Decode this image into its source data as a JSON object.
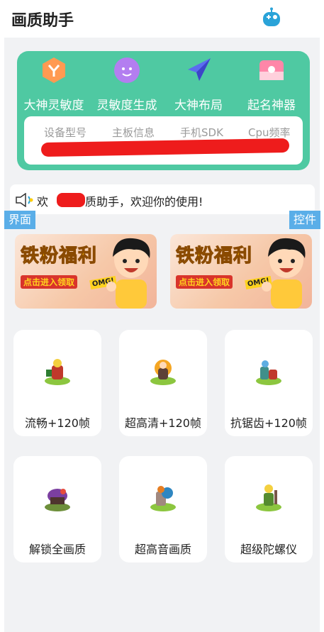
{
  "header": {
    "title": "画质助手",
    "icon": "robot-icon"
  },
  "features": [
    {
      "label": "大神灵敏度",
      "icon": "orange-shield-icon"
    },
    {
      "label": "灵敏度生成",
      "icon": "purple-face-icon"
    },
    {
      "label": "大神布局",
      "icon": "paper-plane-icon"
    },
    {
      "label": "起名神器",
      "icon": "pink-card-icon"
    }
  ],
  "device_info": {
    "labels": [
      "设备型号",
      "主板信息",
      "手机SDK",
      "Cpu频率"
    ]
  },
  "welcome": {
    "text": "欢迎质助手，欢迎你的使用!",
    "prefix": "欢",
    "suffix": "质助手，欢迎你的使用!"
  },
  "tags": {
    "left": "界面",
    "right": "控件"
  },
  "banners": [
    {
      "title": "铁粉福利",
      "subtitle": "点击进入领取",
      "badge": "OMG!"
    },
    {
      "title": "铁粉福利",
      "subtitle": "点击进入领取",
      "badge": "OMG!"
    }
  ],
  "tiles": [
    {
      "label": "流畅+120帧",
      "icon": "game-character-icon"
    },
    {
      "label": "超高清+120帧",
      "icon": "game-character-icon"
    },
    {
      "label": "抗锯齿+120帧",
      "icon": "game-character-icon"
    },
    {
      "label": "解锁全画质",
      "icon": "game-character-icon"
    },
    {
      "label": "超高音画质",
      "icon": "game-character-icon"
    },
    {
      "label": "超级陀螺仪",
      "icon": "game-character-icon"
    }
  ],
  "colors": {
    "accent_green": "#4fc9a2",
    "tag_blue": "#5aaee8",
    "redaction": "#ee1c1c",
    "background": "#f1f2f4"
  }
}
